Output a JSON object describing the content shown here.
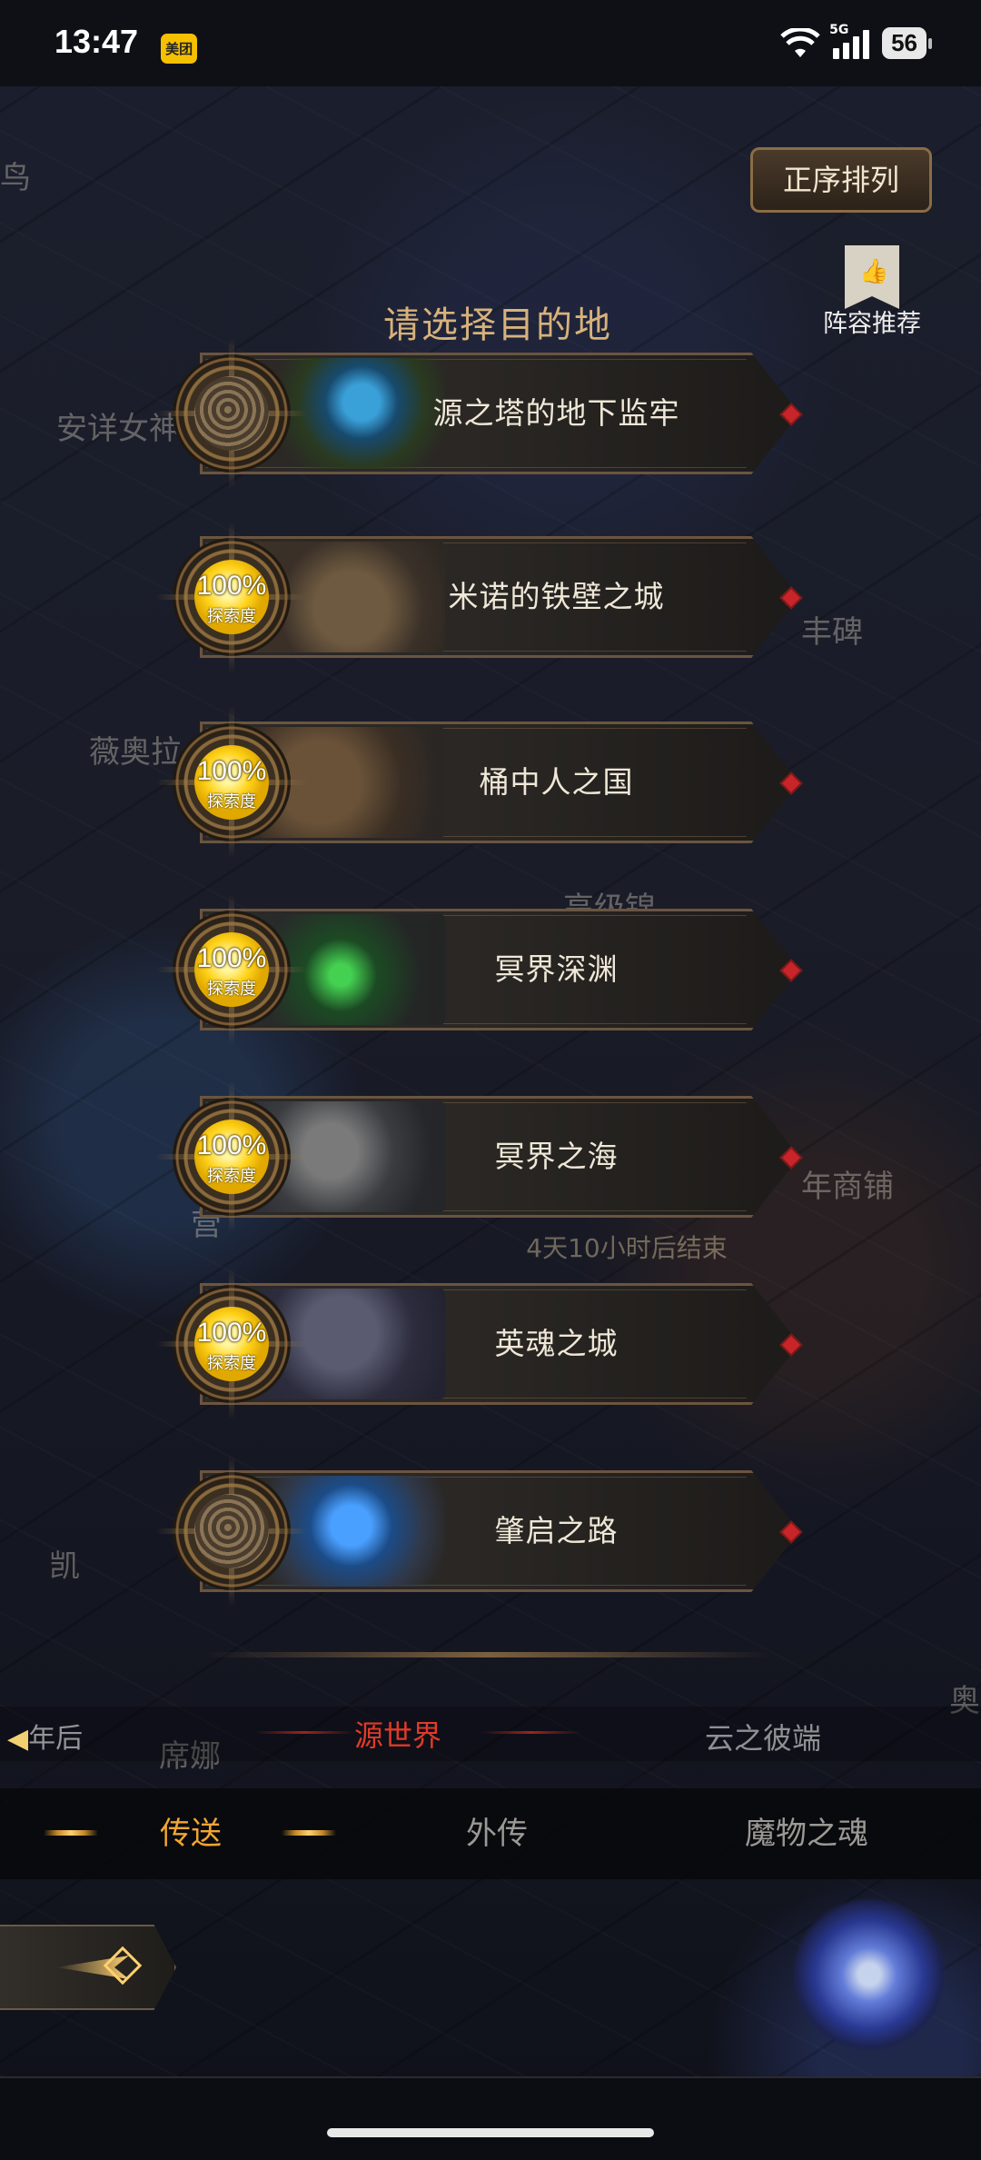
{
  "status_bar": {
    "time": "13:47",
    "app_badge": "美团",
    "network": "5G",
    "battery": "56"
  },
  "background_labels": {
    "label_1": "鸟",
    "label_2": "安详女神",
    "label_3": "丰碑",
    "label_4": "薇奥拉",
    "label_5": "高级锦",
    "label_6": "年商铺",
    "label_7": "营",
    "label_8": "凯",
    "label_9": "奥",
    "label_10": "席娜"
  },
  "header": {
    "sort_button": "正序排列",
    "lineup_recommend": "阵容推荐",
    "lineup_icon": "thumbs-up-icon",
    "title": "请选择目的地"
  },
  "destinations": [
    {
      "name": "源之塔的地下监牢",
      "explored": false,
      "progress": "",
      "progress_label": ""
    },
    {
      "name": "米诺的铁壁之城",
      "explored": true,
      "progress": "100%",
      "progress_label": "探索度"
    },
    {
      "name": "桶中人之国",
      "explored": true,
      "progress": "100%",
      "progress_label": "探索度"
    },
    {
      "name": "冥界深渊",
      "explored": true,
      "progress": "100%",
      "progress_label": "探索度"
    },
    {
      "name": "冥界之海",
      "explored": true,
      "progress": "100%",
      "progress_label": "探索度"
    },
    {
      "name": "英魂之城",
      "explored": true,
      "progress": "100%",
      "progress_label": "探索度"
    },
    {
      "name": "肇启之路",
      "explored": false,
      "progress": "",
      "progress_label": ""
    }
  ],
  "event_timer": "4天10小时后结束",
  "world_nav": {
    "prev": "年后",
    "current": "源世界",
    "next": "云之彼端"
  },
  "tabs": [
    {
      "label": "传送",
      "active": true
    },
    {
      "label": "外传",
      "active": false
    },
    {
      "label": "魔物之魂",
      "active": false
    }
  ],
  "colors": {
    "accent_gold": "#d7b27a",
    "tab_active": "#f2a632",
    "world_current": "#e13a28",
    "explored_gold": "#ffd21a"
  }
}
